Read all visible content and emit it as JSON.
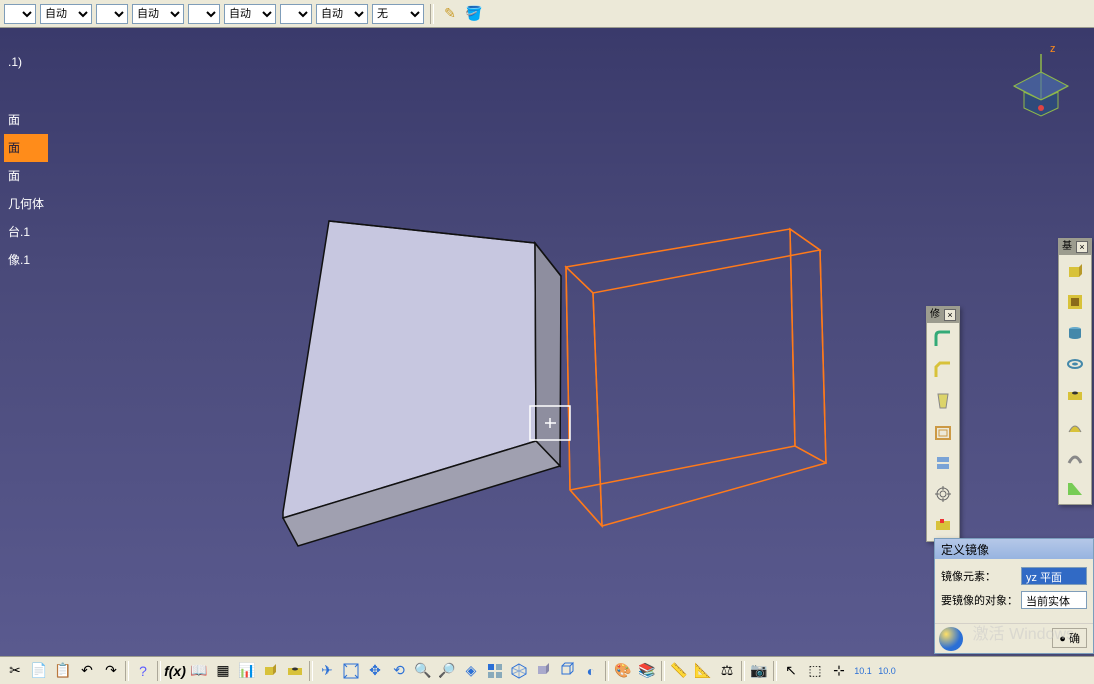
{
  "top_dropdowns": {
    "d1": "",
    "d2": "自动",
    "d3": "",
    "d4": "自动",
    "d5": "",
    "d6": "自动",
    "d7": "",
    "d8": "自动",
    "d9": "无"
  },
  "tree": {
    "item0": ".1)",
    "item1": "面",
    "item2": "面",
    "item3": "面",
    "item4": "几何体",
    "item5": "台.1",
    "item6": "像.1"
  },
  "compass": {
    "z_label": "z"
  },
  "vtool1": {
    "title": "修"
  },
  "vtool2": {
    "title": "基"
  },
  "dialog": {
    "title": "定义镜像",
    "row1_label": "镜像元素：",
    "row1_value": "yz 平面",
    "row2_label": "要镜像的对象：",
    "row2_value": "当前实体",
    "btn_ok": "确"
  },
  "watermark": "激活 Windows",
  "icons": {
    "pencil": "pencil",
    "paint": "paint"
  }
}
